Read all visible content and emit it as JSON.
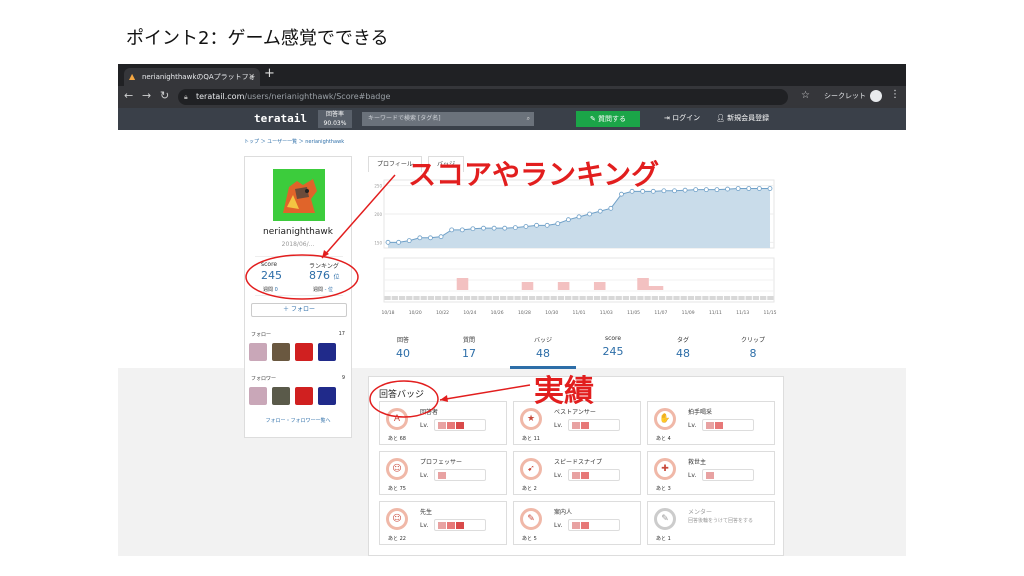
{
  "slide": {
    "title": "ポイント2：ゲーム感覚でできる"
  },
  "browser": {
    "tab_title": "nerianighthawkのQAプラットフォ",
    "url_host": "teratail.com",
    "url_path": "/users/nerianighthawk/Score#badge",
    "incognito_label": "シークレット"
  },
  "site": {
    "logo": "teratail",
    "rate_label": "回答率",
    "rate_value": "90.03%",
    "search_placeholder": "キーワードで検索 [タグ名]",
    "ask_button": "質問する",
    "login": "ログイン",
    "signup": "新規会員登録"
  },
  "breadcrumb": "トップ ＞ ユーザー一覧 ＞ nerianighthawk",
  "profile": {
    "username": "nerianighthawk",
    "since": "2018/06/...",
    "score_label": "score",
    "score_value": "245",
    "score_week_label": "週間",
    "score_week_value": "0",
    "rank_label": "ランキング",
    "rank_value": "876",
    "rank_unit": "位",
    "rank_week_label": "週間",
    "rank_week_value": "-",
    "rank_week_unit": "位",
    "follow_button": "＋ フォロー",
    "follow_label": "フォロー",
    "follow_count": "17",
    "follower_label": "フォロワー",
    "follower_count": "9",
    "follow_link": "フォロー・フォロワー一覧へ"
  },
  "tabs": {
    "profile_tab": "プロフィール",
    "next_tab": "バッジ"
  },
  "chart_data": {
    "type": "line",
    "title": "",
    "x": [
      "10/18",
      "10/20",
      "10/22",
      "10/24",
      "10/26",
      "10/28",
      "10/30",
      "11/01",
      "11/03",
      "11/05",
      "11/07",
      "11/09",
      "11/11",
      "11/13",
      "11/15"
    ],
    "yticks": [
      "250",
      "200",
      "150"
    ],
    "series": [
      {
        "values": [
          150,
          150,
          153,
          158,
          158,
          160,
          172,
          172,
          174,
          175,
          175,
          175,
          176,
          178,
          180,
          180,
          183,
          190,
          195,
          200,
          205,
          210,
          235,
          240,
          240,
          240,
          241,
          241,
          242,
          243,
          243,
          243,
          244,
          245,
          245,
          245,
          245
        ]
      }
    ],
    "bars_values": [
      0,
      0,
      0,
      0,
      0,
      0,
      0,
      0,
      0,
      0,
      3,
      0,
      0,
      0,
      0,
      0,
      0,
      0,
      0,
      2,
      0,
      0,
      0,
      0,
      2,
      0,
      0,
      0,
      0,
      2,
      0,
      0,
      0,
      0,
      0,
      3,
      1,
      1,
      0,
      0,
      0,
      0,
      0,
      0,
      0,
      0,
      0,
      0,
      0,
      0,
      0,
      0,
      0,
      0
    ]
  },
  "stats": [
    {
      "label": "回答",
      "value": "40"
    },
    {
      "label": "質問",
      "value": "17"
    },
    {
      "label": "バッジ",
      "value": "48"
    },
    {
      "label": "score",
      "value": "245"
    },
    {
      "label": "タグ",
      "value": "48"
    },
    {
      "label": "クリップ",
      "value": "8"
    }
  ],
  "badge_panel_title": "回答バッジ",
  "badges": [
    {
      "name": "回答者",
      "lv": "Lv.",
      "remain": "あと 68",
      "icon": "A",
      "level": 3
    },
    {
      "name": "ベストアンサー",
      "lv": "Lv.",
      "remain": "あと 11",
      "icon": "★",
      "level": 2
    },
    {
      "name": "拍手喝采",
      "lv": "Lv.",
      "remain": "あと 4",
      "icon": "✋",
      "level": 2
    },
    {
      "name": "プロフェッサー",
      "lv": "Lv.",
      "remain": "あと 75",
      "icon": "☺",
      "level": 1
    },
    {
      "name": "スピードスナイプ",
      "lv": "Lv.",
      "remain": "あと 2",
      "icon": "➹",
      "level": 2
    },
    {
      "name": "救世主",
      "lv": "Lv.",
      "remain": "あと 3",
      "icon": "✚",
      "level": 1
    },
    {
      "name": "先生",
      "lv": "Lv.",
      "remain": "あと 22",
      "icon": "☺",
      "level": 3
    },
    {
      "name": "案内人",
      "lv": "Lv.",
      "remain": "あと 5",
      "icon": "✎",
      "level": 2
    },
    {
      "name": "メンター",
      "desc": "回答後輪をうけて回答をする",
      "remain": "あと 1",
      "icon": "✎",
      "level": 0
    }
  ],
  "annotations": {
    "ranking": "スコアやランキング",
    "achievement": "実績"
  },
  "colors": {
    "accent_blue": "#2d6ea8",
    "annotation_red": "#e21e1e",
    "teratail_green": "#1ba548"
  }
}
